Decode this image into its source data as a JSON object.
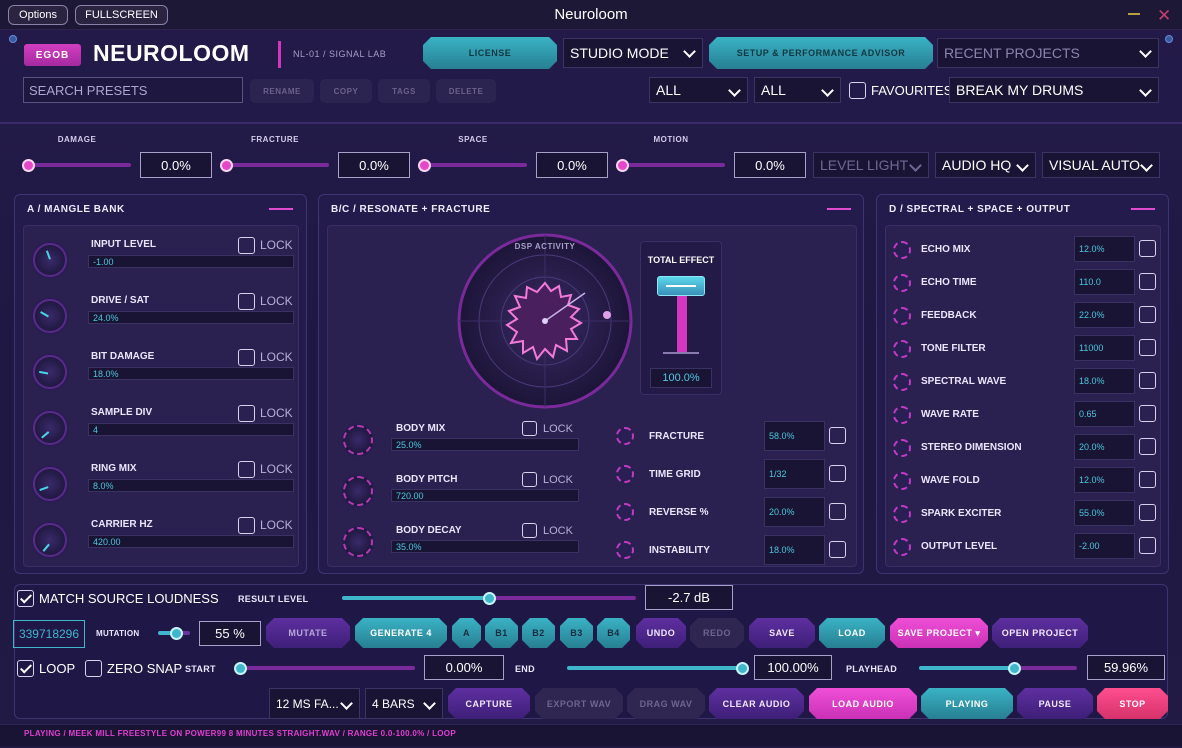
{
  "titlebar": {
    "options": "Options",
    "fullscreen": "FULLSCREEN",
    "title": "Neuroloom"
  },
  "header": {
    "badge": "EGOB",
    "brand": "NEUROLOOM",
    "sub": "NL-01  /  SIGNAL LAB",
    "license": "LICENSE",
    "mode": "STUDIO MODE",
    "advisor": "SETUP & PERFORMANCE ADVISOR",
    "recent": "RECENT PROJECTS",
    "search_placeholder": "SEARCH PRESETS",
    "rename": "RENAME",
    "copy": "COPY",
    "tags": "TAGS",
    "delete": "DELETE",
    "filter1": "ALL",
    "filter2": "ALL",
    "favourites": "FAVOURITES",
    "preset": "BREAK MY DRUMS"
  },
  "macros": [
    {
      "label": "DAMAGE",
      "value": "0.0%"
    },
    {
      "label": "FRACTURE",
      "value": "0.0%"
    },
    {
      "label": "SPACE",
      "value": "0.0%"
    },
    {
      "label": "MOTION",
      "value": "0.0%"
    }
  ],
  "quality": {
    "level": "LEVEL LIGHT",
    "audio": "AUDIO HQ",
    "visual": "VISUAL AUTO"
  },
  "panelA": {
    "title": "A  /  MANGLE BANK",
    "lock": "LOCK",
    "items": [
      {
        "label": "INPUT LEVEL",
        "value": "-1.00",
        "angle": -20
      },
      {
        "label": "DRIVE / SAT",
        "value": "24.0%",
        "angle": -60
      },
      {
        "label": "BIT DAMAGE",
        "value": "18.0%",
        "angle": -80
      },
      {
        "label": "SAMPLE DIV",
        "value": "4",
        "angle": -130
      },
      {
        "label": "RING MIX",
        "value": "8.0%",
        "angle": -110
      },
      {
        "label": "CARRIER HZ",
        "value": "420.00",
        "angle": -140
      }
    ]
  },
  "panelBC": {
    "title": "B/C  /  RESONATE + FRACTURE",
    "dsp": "DSP ACTIVITY",
    "total_effect": "TOTAL EFFECT",
    "total_value": "100.0%",
    "lock": "LOCK",
    "body": [
      {
        "label": "BODY MIX",
        "value": "25.0%"
      },
      {
        "label": "BODY PITCH",
        "value": "720.00"
      },
      {
        "label": "BODY DECAY",
        "value": "35.0%"
      }
    ],
    "fx": [
      {
        "label": "FRACTURE",
        "value": "58.0%"
      },
      {
        "label": "TIME GRID",
        "value": "1/32"
      },
      {
        "label": "REVERSE %",
        "value": "20.0%"
      },
      {
        "label": "INSTABILITY",
        "value": "18.0%"
      }
    ]
  },
  "panelD": {
    "title": "D  /  SPECTRAL + SPACE + OUTPUT",
    "items": [
      {
        "label": "ECHO MIX",
        "value": "12.0%"
      },
      {
        "label": "ECHO TIME",
        "value": "110.0"
      },
      {
        "label": "FEEDBACK",
        "value": "22.0%"
      },
      {
        "label": "TONE FILTER",
        "value": "11000"
      },
      {
        "label": "SPECTRAL WAVE",
        "value": "18.0%"
      },
      {
        "label": "WAVE RATE",
        "value": "0.65"
      },
      {
        "label": "STEREO DIMENSION",
        "value": "20.0%"
      },
      {
        "label": "WAVE FOLD",
        "value": "12.0%"
      },
      {
        "label": "SPARK EXCITER",
        "value": "55.0%"
      },
      {
        "label": "OUTPUT LEVEL",
        "value": "-2.00"
      }
    ]
  },
  "bottom": {
    "match": "MATCH SOURCE LOUDNESS",
    "result_label": "RESULT LEVEL",
    "result_value": "-2.7 dB",
    "result_pos": 0.5,
    "seed": "339718296",
    "mutation_label": "MUTATION",
    "mutation_value": "55 %",
    "mutation_pos": 0.55,
    "mutate": "MUTATE",
    "generate": "GENERATE 4",
    "slots": [
      "A",
      "B1",
      "B2",
      "B3",
      "B4"
    ],
    "undo": "UNDO",
    "redo": "REDO",
    "save": "SAVE",
    "load": "LOAD",
    "save_project": "SAVE PROJECT ▾",
    "open_project": "OPEN PROJECT",
    "loop": "LOOP",
    "zero_snap": "ZERO SNAP",
    "start_label": "START",
    "start_value": "0.00%",
    "end_label": "END",
    "end_value": "100.00%",
    "playhead_label": "PLAYHEAD",
    "playhead_value": "59.96%",
    "playhead_pos": 0.5996,
    "fade": "12 MS FA...",
    "bars": "4 BARS",
    "capture": "CAPTURE",
    "export": "EXPORT WAV",
    "drag": "DRAG WAV",
    "clear": "CLEAR AUDIO",
    "load_audio": "LOAD AUDIO",
    "playing": "PLAYING",
    "pause": "PAUSE",
    "stop": "STOP"
  },
  "status": "PLAYING  /  MEEK MILL FREESTYLE ON POWER99 8 MINUTES STRAIGHT.WAV  /  RANGE 0.0-100.0%  /  LOOP",
  "colors": {
    "accent_pink": "#e23ed0",
    "accent_teal": "#3ab3c5",
    "bg": "#1e1842"
  }
}
